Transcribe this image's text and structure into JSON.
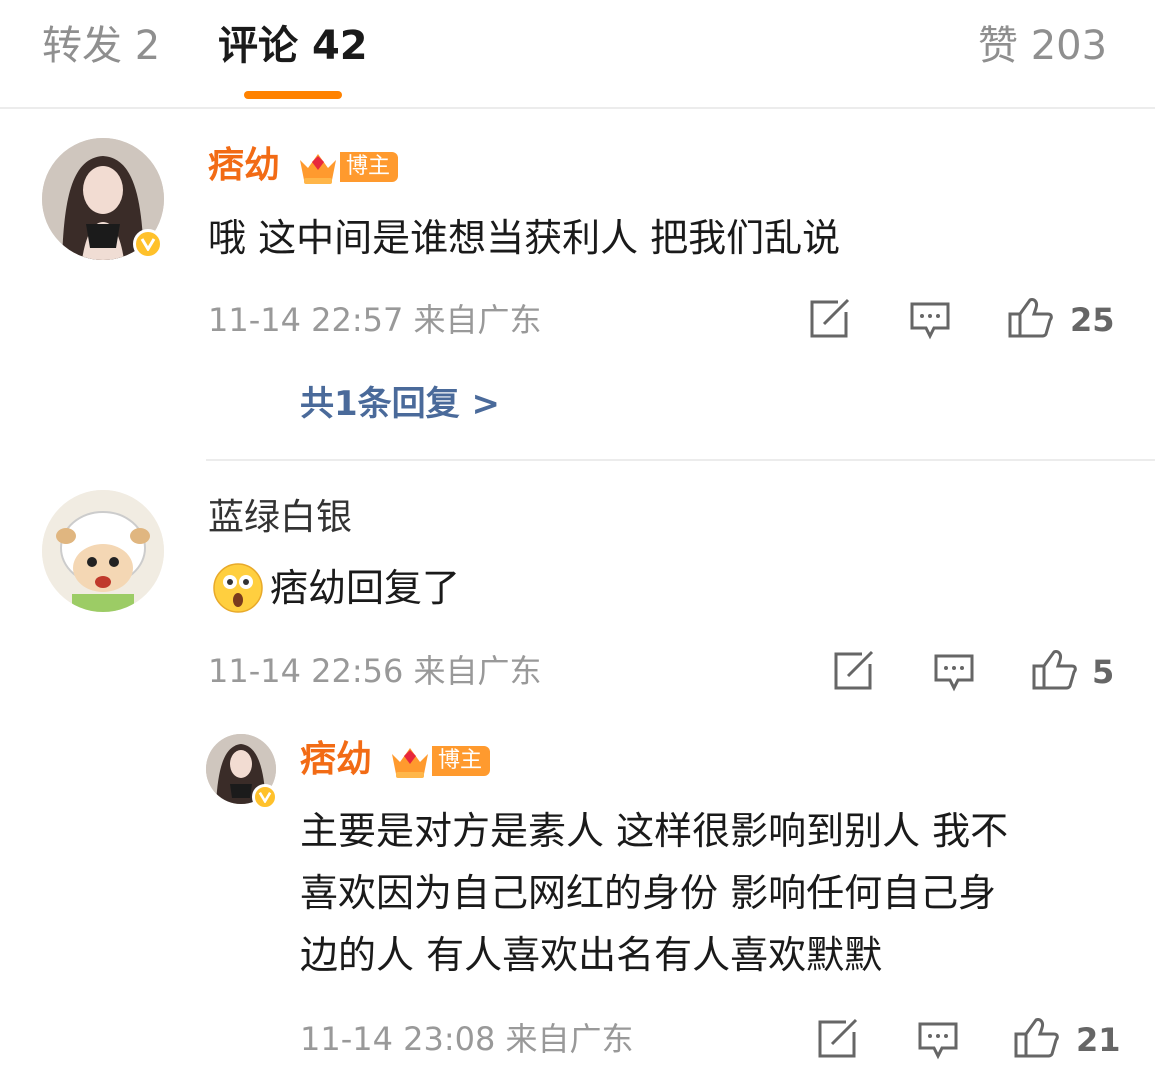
{
  "tabs": [
    {
      "label": "转发",
      "count": "2"
    },
    {
      "label": "评论",
      "count": "42"
    },
    {
      "label": "赞",
      "count": "203"
    }
  ],
  "colors": {
    "accent": "#ff8200",
    "username": "#f26b15",
    "link": "#4a6a9a",
    "meta": "#999999"
  },
  "comments": [
    {
      "user": "痞幼",
      "badge": "博主",
      "verified": true,
      "text": "哦 这中间是谁想当获利人 把我们乱说",
      "time": "11-14 22:57",
      "location": "来自广东",
      "likes": "25",
      "replies_link": "共1条回复 >"
    },
    {
      "user": "蓝绿白银",
      "emoji": "astonished-face",
      "text": "痞幼回复了",
      "time": "11-14 22:56",
      "location": "来自广东",
      "likes": "5"
    }
  ],
  "reply": {
    "user": "痞幼",
    "badge": "博主",
    "verified": true,
    "text_lines": [
      "主要是对方是素人 这样很影响到别人 我不",
      "喜欢因为自己网红的身份 影响任何自己身",
      "边的人 有人喜欢出名有人喜欢默默"
    ],
    "time": "11-14 23:08",
    "location": "来自广东",
    "likes": "21"
  },
  "icons": [
    "share-icon",
    "comment-icon",
    "like-icon",
    "crown-icon",
    "verified-icon"
  ]
}
